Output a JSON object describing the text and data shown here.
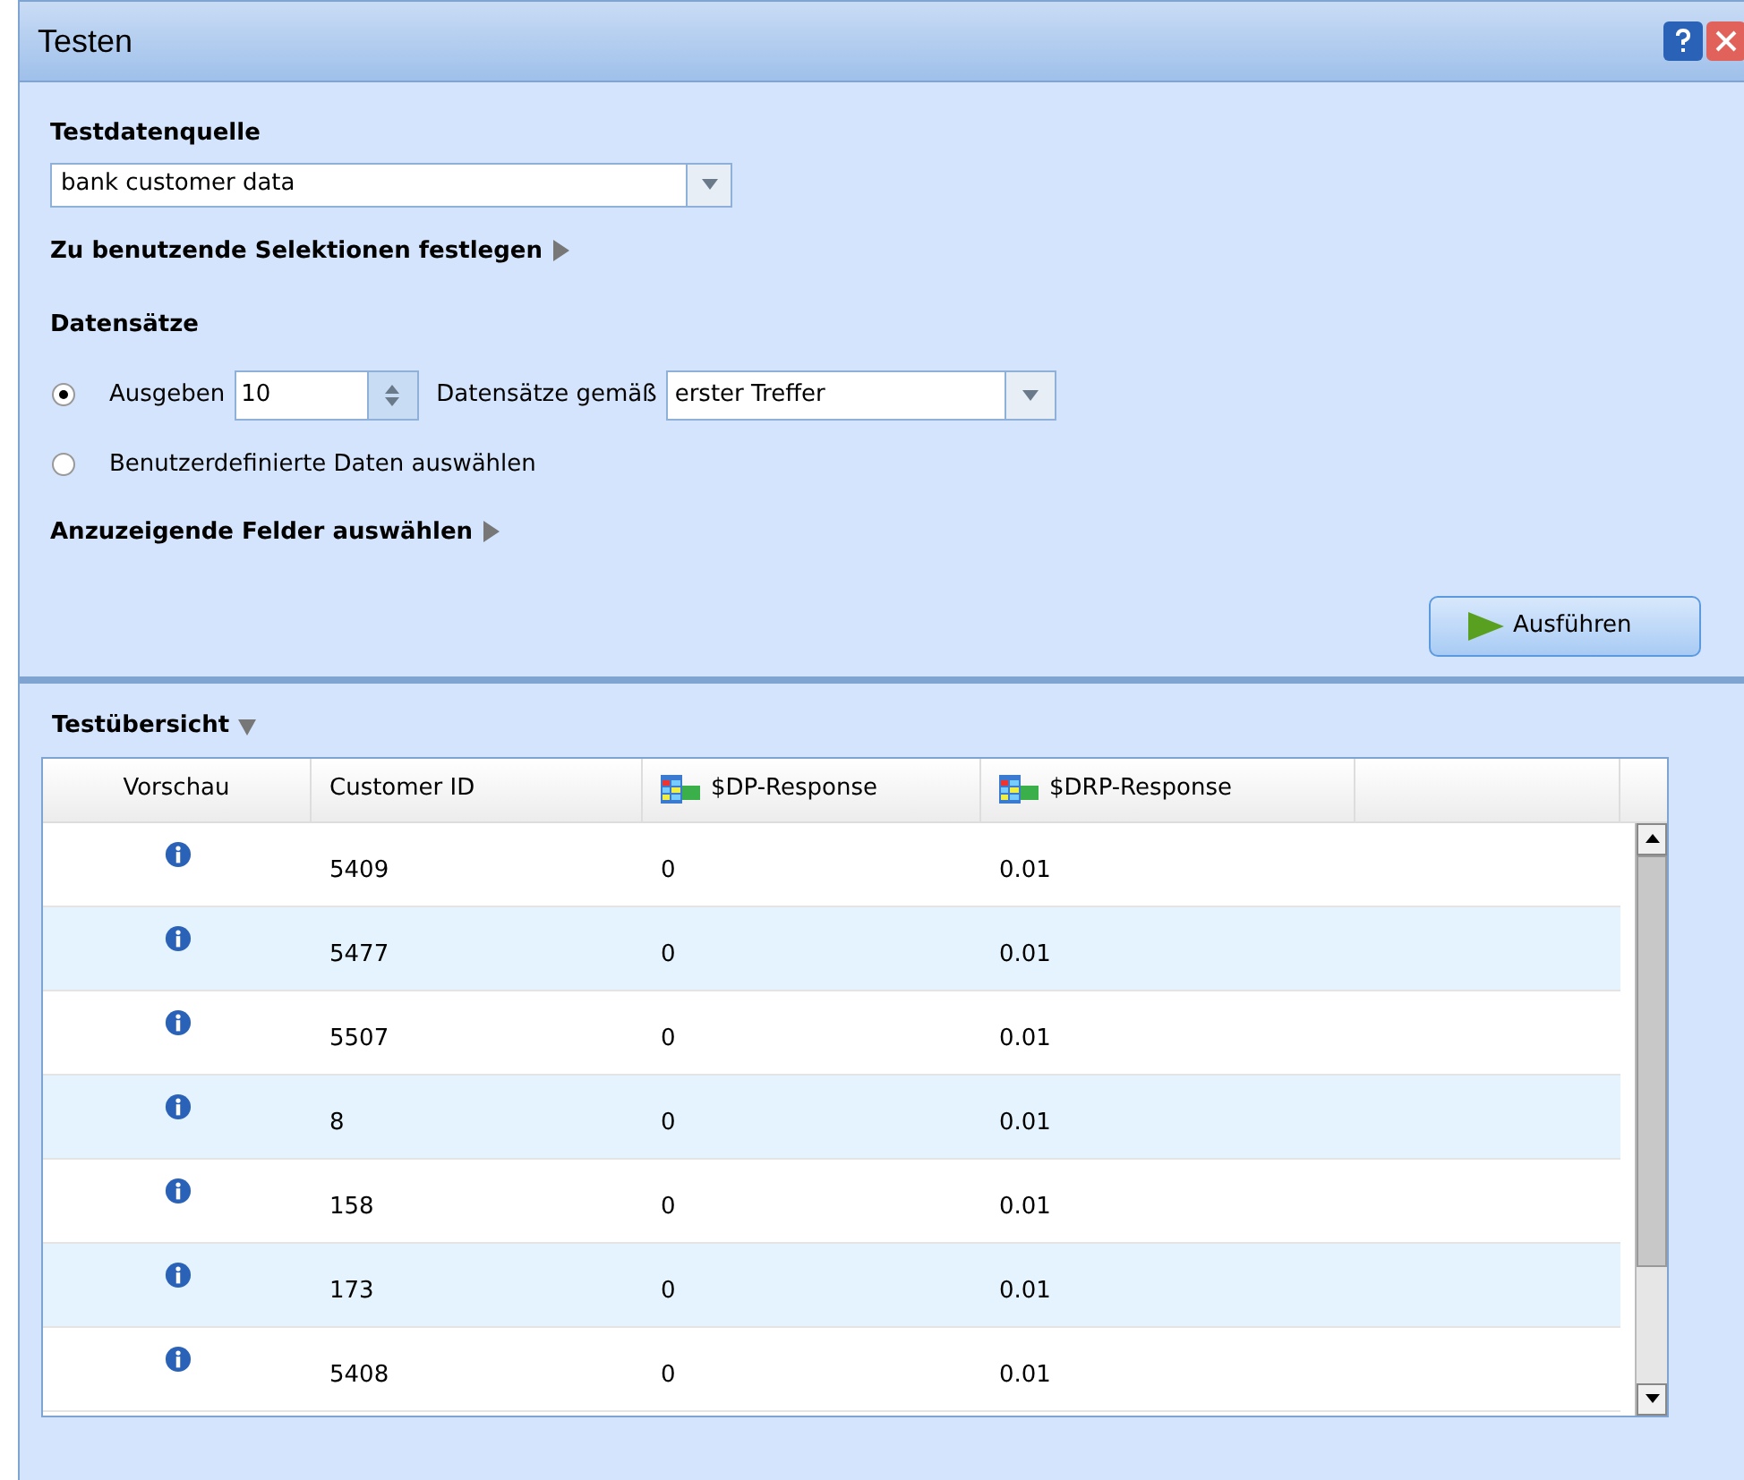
{
  "window": {
    "title": "Testen"
  },
  "source": {
    "label": "Testdatenquelle",
    "value": "bank customer data"
  },
  "selections_link": {
    "label": "Zu benutzende Selektionen festlegen",
    "expanded": false
  },
  "records": {
    "label": "Datensätze",
    "options": [
      {
        "kind": "count",
        "selected": true,
        "label": "Ausgeben",
        "count": "10",
        "after": "Datensätze gemäß",
        "mode": "erster Treffer"
      },
      {
        "kind": "plain",
        "selected": false,
        "label": "Benutzerdefinierte Daten auswählen"
      }
    ]
  },
  "fields_link": {
    "label": "Anzuzeigende Felder auswählen",
    "expanded": false
  },
  "run_button": "Ausführen",
  "overview": {
    "label": "Testübersicht",
    "expanded": true
  },
  "table": {
    "columns": [
      {
        "label": "Vorschau",
        "kind": "plain"
      },
      {
        "label": "Customer ID",
        "kind": "plain"
      },
      {
        "label": "$DP-Response",
        "kind": "field"
      },
      {
        "label": "$DRP-Response",
        "kind": "field"
      }
    ],
    "rows": [
      {
        "id": "5409",
        "dp": "0",
        "drp": "0.01"
      },
      {
        "id": "5477",
        "dp": "0",
        "drp": "0.01"
      },
      {
        "id": "5507",
        "dp": "0",
        "drp": "0.01"
      },
      {
        "id": "8",
        "dp": "0",
        "drp": "0.01"
      },
      {
        "id": "158",
        "dp": "0",
        "drp": "0.01"
      },
      {
        "id": "173",
        "dp": "0",
        "drp": "0.01"
      },
      {
        "id": "5408",
        "dp": "0",
        "drp": "0.01"
      }
    ]
  }
}
